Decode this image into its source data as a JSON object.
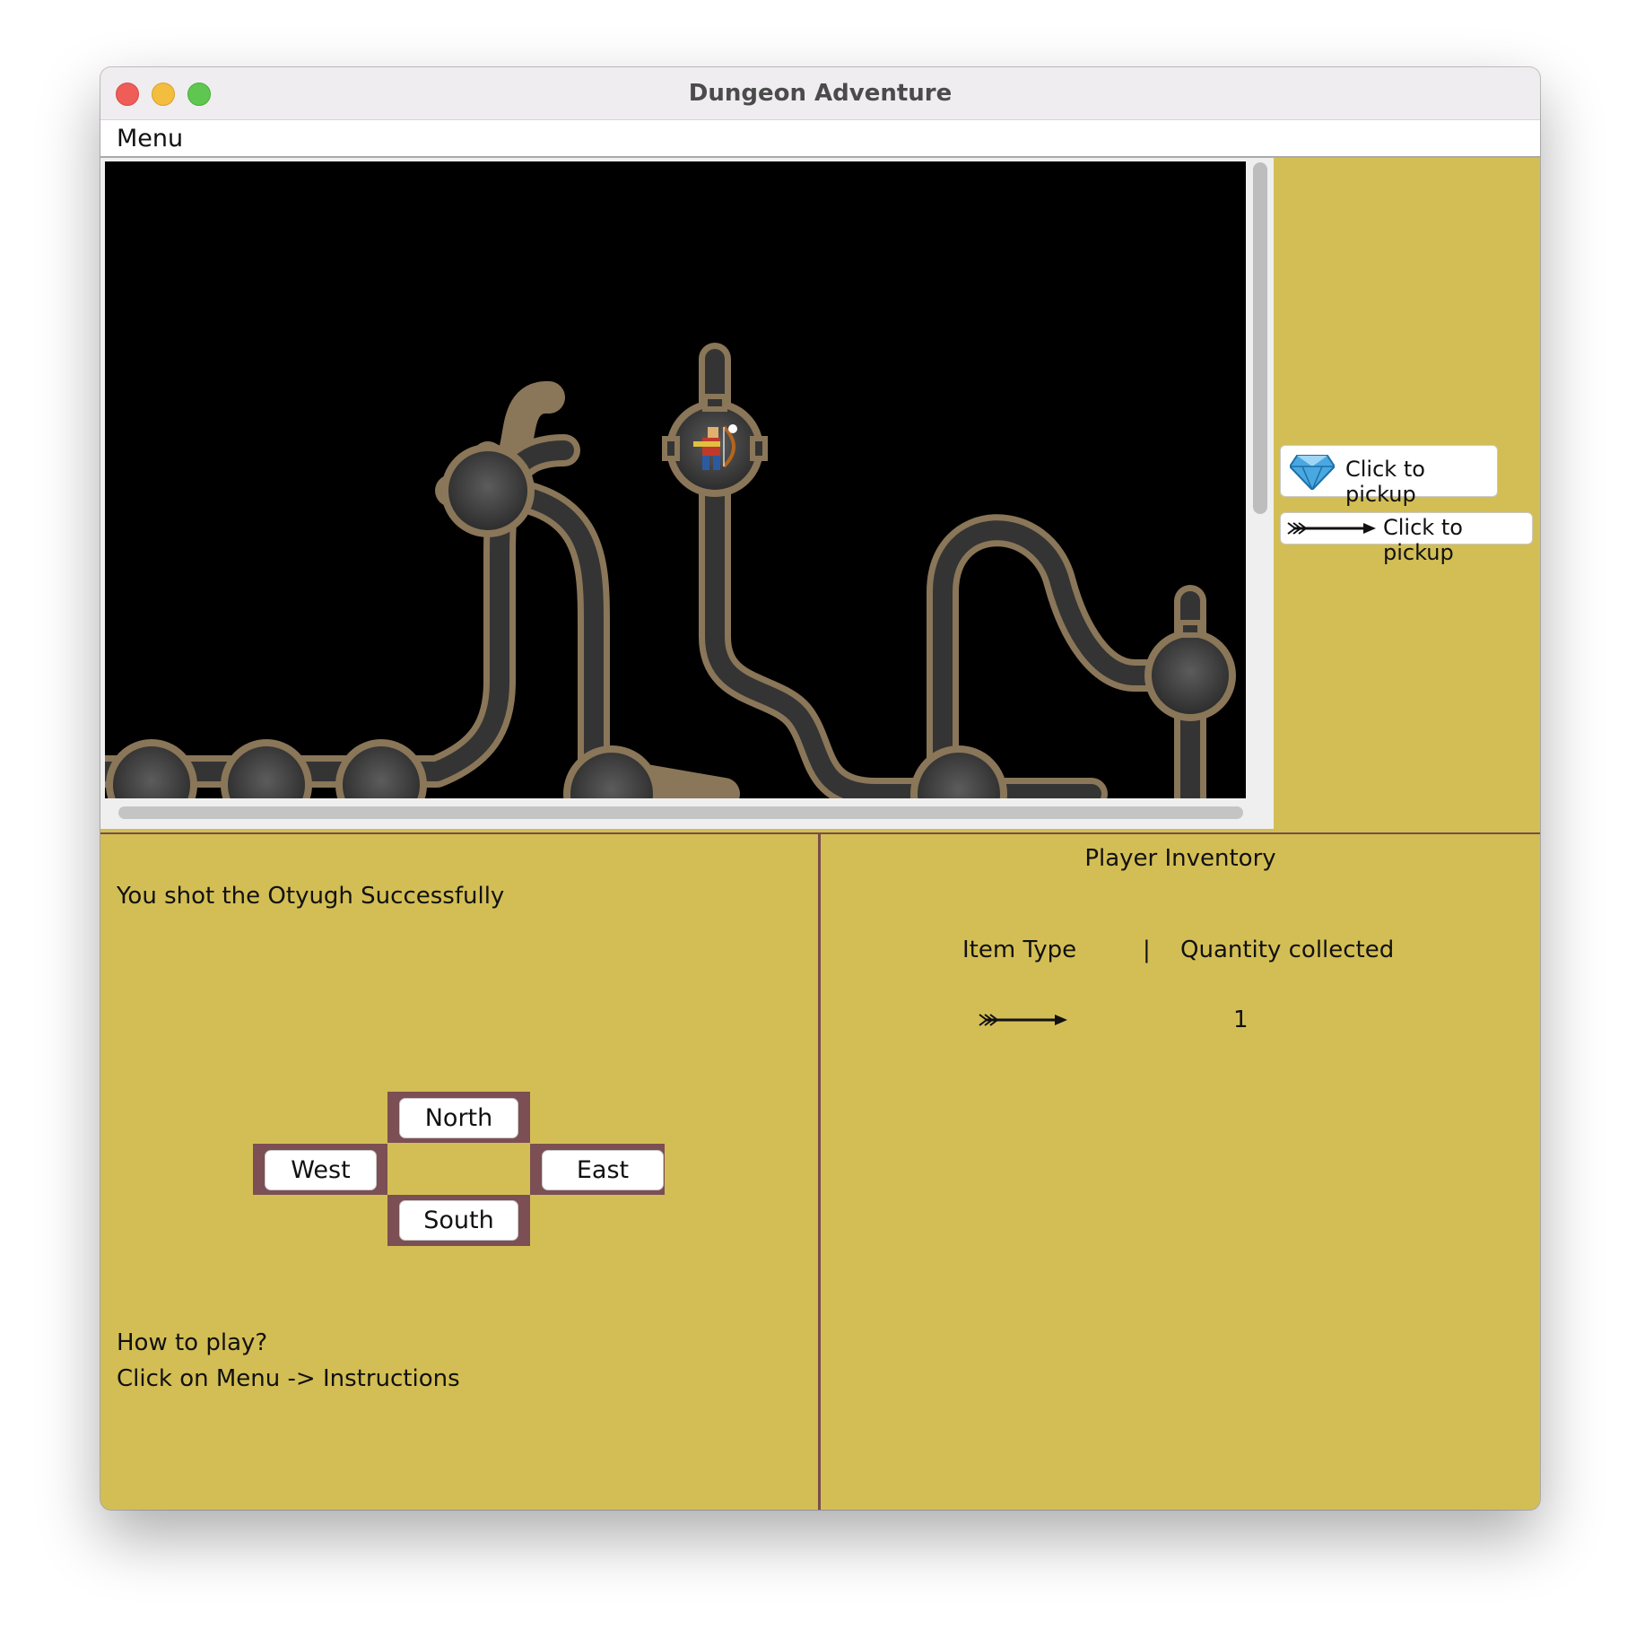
{
  "window": {
    "title": "Dungeon Adventure"
  },
  "menubar": {
    "menu_label": "Menu"
  },
  "pickups": [
    {
      "icon": "gem-icon",
      "label": "Click to pickup"
    },
    {
      "icon": "arrow-icon",
      "label": "Click to pickup"
    }
  ],
  "status": {
    "message": "You shot the Otyugh Successfully"
  },
  "directions": {
    "north": "North",
    "west": "West",
    "east": "East",
    "south": "South"
  },
  "help": {
    "line1": "How to play?",
    "line2": "Click on Menu -> Instructions"
  },
  "inventory": {
    "title": "Player Inventory",
    "col_item": "Item Type",
    "col_sep": "|",
    "col_qty": "Quantity collected",
    "rows": [
      {
        "icon": "arrow-icon",
        "quantity": "1"
      }
    ]
  },
  "colors": {
    "panel": "#d3be55",
    "border": "#7a4c4c",
    "dungeon_bg": "#000000"
  }
}
